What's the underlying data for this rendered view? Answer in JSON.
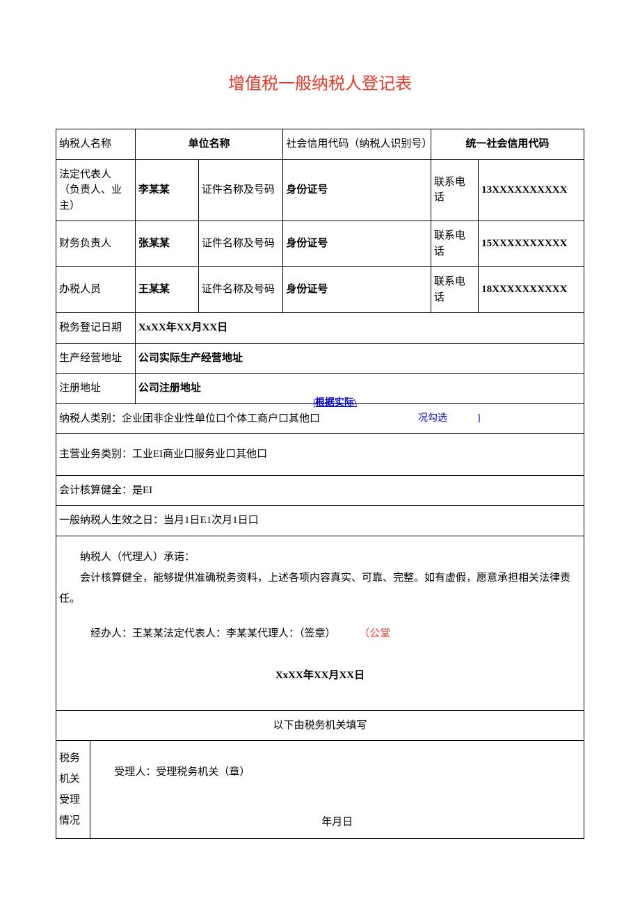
{
  "title": "增值税一般纳税人登记表",
  "row1": {
    "l1": "纳税人名称",
    "l2": "单位名称",
    "l3": "社会信用代码（纳税人识别号）",
    "l4": "统一社会信用代码"
  },
  "row2": {
    "l1": "法定代表人（负责人、业主）",
    "v1": "李某某",
    "l2": "证件名称及号码",
    "v2": "身份证号",
    "l3": "联系电话",
    "v3": "13XXXXXXXXXX"
  },
  "row3": {
    "l1": "财务负责人",
    "v1": "张某某",
    "l2": "证件名称及号码",
    "v2": "身份证号",
    "l3": "联系电话",
    "v3": "15XXXXXXXXXX"
  },
  "row4": {
    "l1": "办税人员",
    "v1": "王某某",
    "l2": "证件名称及号码",
    "v2": "身份证号",
    "l3": "联系电话",
    "v3": "18XXXXXXXXXX"
  },
  "row5": {
    "l1": "税务登记日期",
    "v1": "XxXX年XX月XX日"
  },
  "row6": {
    "l1": "生产经营地址",
    "v1": "公司实际生产经营地址"
  },
  "row7": {
    "l1": "注册地址",
    "v1": "公司注册地址"
  },
  "annot1": "|根据实际\\",
  "annot2": "况勾选",
  "annot3": "]",
  "row8": "纳税人类别：企业团非企业性单位口个体工商户口其他口",
  "row9": "主营业务类别：工业EI商业口服务业口其他口",
  "row10": "会计核算健全：是EI",
  "row11": "一般纳税人生效之日：当月1日E1次月1日口",
  "promise": {
    "p1": "纳税人（代理人）承诺：",
    "p2": "会计核算健全，能够提供准确税务资料，上述各项内容真实、可靠、完整。如有虚假，愿意承担相关法律责任。",
    "p3a": "经办人：王某某法定代表人：李某某代理人：（签章）",
    "p3b": "（公堂",
    "date": "XxXX年XX月XX日"
  },
  "row12": "以下由税务机关填写",
  "row13": {
    "l1": "税务机关受理情况",
    "l2": "受理人：受理税务机关（章）",
    "date": "年月日"
  }
}
